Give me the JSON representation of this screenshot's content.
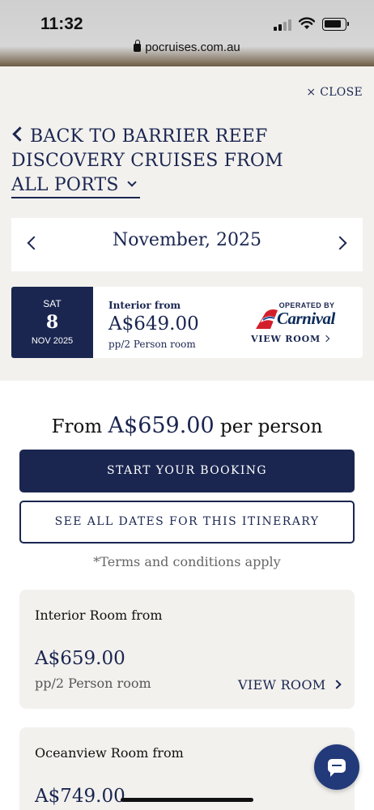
{
  "status_bar": {
    "time": "11:32",
    "url": "pocruises.com.au"
  },
  "modal": {
    "close_label": "× CLOSE",
    "back_line1": "BACK TO BARRIER REEF",
    "back_line2": "DISCOVERY CRUISES FROM",
    "back_line3": "ALL PORTS",
    "month": "November, 2025"
  },
  "sailing": {
    "day_of_week": "SAT",
    "day": "8",
    "month_year": "NOV 2025",
    "label": "Interior from",
    "price": "A$649.00",
    "sub": "pp/2 Person room",
    "operated_by": "OPERATED BY",
    "operator": "Carnival",
    "view_room": "VIEW ROOM"
  },
  "summary": {
    "from_text": "From",
    "price": "A$659.00",
    "per_person": "per person",
    "start_booking": "START YOUR BOOKING",
    "see_all_dates": "SEE ALL DATES FOR THIS ITINERARY",
    "terms": "*Terms and conditions apply"
  },
  "rooms": [
    {
      "title": "Interior Room from",
      "price": "A$659.00",
      "sub": "pp/2 Person room",
      "view": "VIEW ROOM"
    },
    {
      "title": "Oceanview Room from",
      "price": "A$749.00"
    }
  ],
  "colors": {
    "navy": "#1a2650",
    "panel": "#f3f1ee",
    "carnival_red": "#d21f2b",
    "carnival_blue": "#0b2a5a"
  },
  "icons": {
    "chat": "chat-bubble-icon",
    "lock": "lock-icon"
  }
}
